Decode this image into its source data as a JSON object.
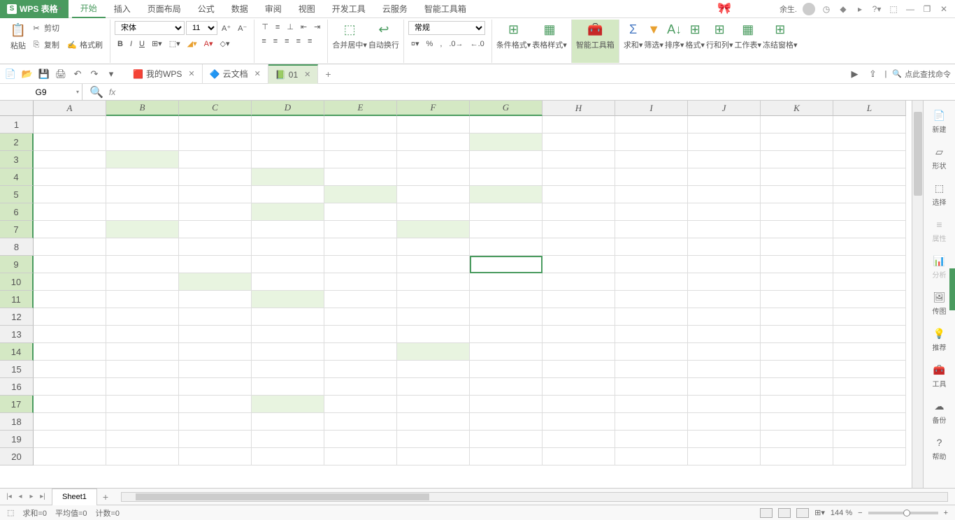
{
  "app": {
    "name": "WPS 表格"
  },
  "menu": {
    "tabs": [
      "开始",
      "插入",
      "页面布局",
      "公式",
      "数据",
      "审阅",
      "视图",
      "开发工具",
      "云服务",
      "智能工具箱"
    ],
    "active": 0
  },
  "titlebar": {
    "user_label": "余生."
  },
  "ribbon": {
    "paste": "粘贴",
    "cut": "剪切",
    "copy": "复制",
    "format_painter": "格式刷",
    "font": "宋体",
    "font_size": "11",
    "merge_center": "合并居中",
    "auto_wrap": "自动换行",
    "number_format": "常规",
    "cond_fmt": "条件格式",
    "table_style": "表格样式",
    "smart_toolbox": "智能工具箱",
    "sum": "求和",
    "filter": "筛选",
    "sort": "排序",
    "format": "格式",
    "row_col": "行和列",
    "worksheet": "工作表",
    "freeze": "冻结窗格"
  },
  "doc_tabs": {
    "items": [
      "我的WPS",
      "云文档",
      "01"
    ],
    "active": 2
  },
  "qat_right": {
    "search_placeholder": "点此查找命令"
  },
  "cell_ref": "G9",
  "columns": [
    "A",
    "B",
    "C",
    "D",
    "E",
    "F",
    "G",
    "H",
    "I",
    "J",
    "K",
    "L"
  ],
  "rows": [
    "1",
    "2",
    "3",
    "4",
    "5",
    "6",
    "7",
    "8",
    "9",
    "10",
    "11",
    "12",
    "13",
    "14",
    "15",
    "16",
    "17",
    "18",
    "19",
    "20"
  ],
  "highlighted_cells": [
    {
      "r": 1,
      "c": 6
    },
    {
      "r": 2,
      "c": 1
    },
    {
      "r": 3,
      "c": 3
    },
    {
      "r": 4,
      "c": 4
    },
    {
      "r": 4,
      "c": 6
    },
    {
      "r": 5,
      "c": 3
    },
    {
      "r": 6,
      "c": 1
    },
    {
      "r": 6,
      "c": 5
    },
    {
      "r": 9,
      "c": 2
    },
    {
      "r": 10,
      "c": 3
    },
    {
      "r": 13,
      "c": 5
    },
    {
      "r": 16,
      "c": 3
    }
  ],
  "active_cell": {
    "r": 8,
    "c": 6
  },
  "selected_cols": [
    1,
    2,
    3,
    4,
    5,
    6
  ],
  "selected_rows": [
    1,
    2,
    3,
    4,
    5,
    6,
    8,
    9,
    10,
    13,
    16
  ],
  "sheet_tabs": {
    "active": "Sheet1"
  },
  "side": {
    "items": [
      "新建",
      "形状",
      "选择",
      "属性",
      "分析",
      "传图",
      "推荐",
      "工具",
      "备份",
      "帮助"
    ],
    "disabled": [
      3,
      4
    ]
  },
  "status": {
    "sum": "求和=0",
    "avg": "平均值=0",
    "count": "计数=0",
    "zoom": "144 %"
  }
}
